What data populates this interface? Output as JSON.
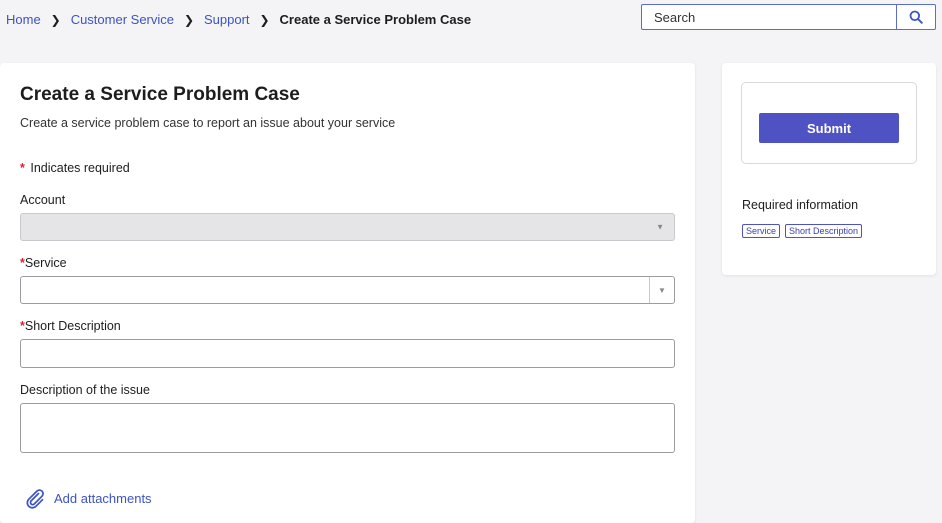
{
  "breadcrumb": {
    "items": [
      "Home",
      "Customer Service",
      "Support"
    ],
    "current": "Create a Service Problem Case"
  },
  "search": {
    "placeholder": "Search",
    "icon": "search-icon"
  },
  "form": {
    "title": "Create a Service Problem Case",
    "subtitle": "Create a service problem case to report an issue about your service",
    "required_note": "Indicates required",
    "fields": {
      "account": {
        "label": "Account",
        "value": ""
      },
      "service": {
        "label": "Service",
        "value": ""
      },
      "short_description": {
        "label": "Short Description",
        "value": ""
      },
      "description": {
        "label": "Description of the issue",
        "value": ""
      }
    },
    "attachments_label": "Add attachments"
  },
  "sidebar": {
    "submit_label": "Submit",
    "required_info_label": "Required information",
    "required_tags": [
      "Service",
      "Short Description"
    ]
  },
  "colors": {
    "accent": "#4f52c2",
    "link": "#3b53c4",
    "required": "#d9232e"
  }
}
